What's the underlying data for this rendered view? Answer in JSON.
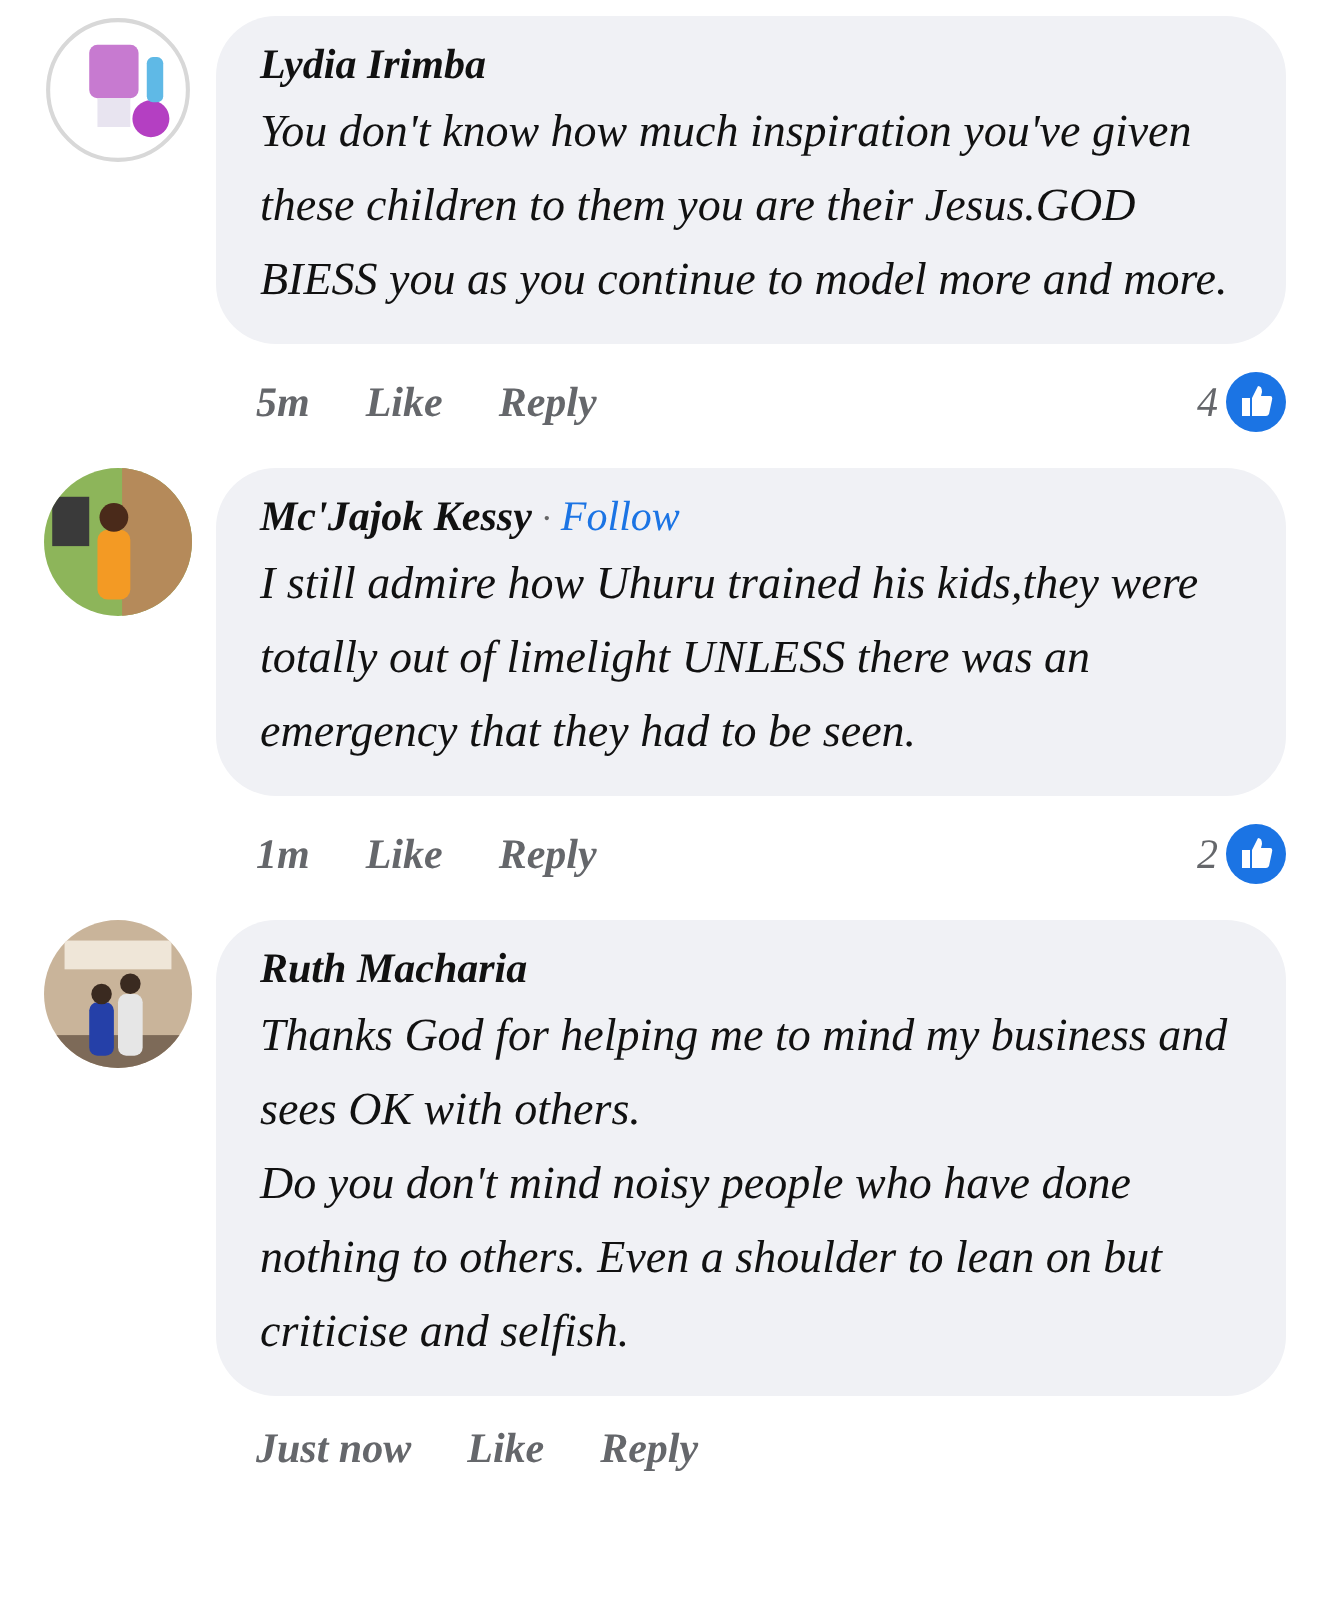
{
  "comments": [
    {
      "avatar": {
        "kind": "picture"
      },
      "author": "Lydia Irimba",
      "body": "You don't know how much inspiration  you've given these  children  to them you are their Jesus.GOD BIESS you as you continue to model more and more.",
      "time": "5m",
      "actions": [
        "Like",
        "Reply"
      ],
      "reactions": "4"
    },
    {
      "avatar": {
        "kind": "picture"
      },
      "author": "Mc'Jajok Kessy",
      "separator": "·",
      "follow": "Follow",
      "body": "I still admire how Uhuru trained his kids,they were totally out of limelight UNLESS there was an emergency that they had to be seen.",
      "time": "1m",
      "actions": [
        "Like",
        "Reply"
      ],
      "reactions": "2"
    },
    {
      "avatar": {
        "kind": "picture"
      },
      "author": "Ruth Macharia",
      "body": "Thanks God for helping me to mind my business and sees OK with others.\nDo you don't mind noisy people who have done nothing to others. Even a shoulder to lean on but criticise and selfish.",
      "time": "Just now",
      "actions": [
        "Like",
        "Reply"
      ]
    }
  ]
}
